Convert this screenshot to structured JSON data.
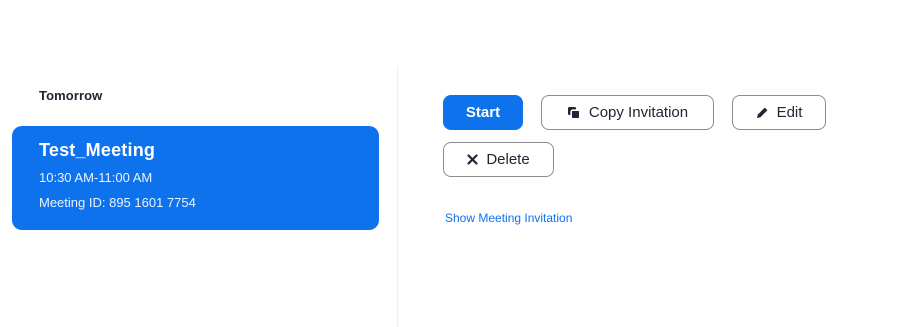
{
  "meeting_list": {
    "section_heading": "Tomorrow",
    "selected_meeting": {
      "title": "Test_Meeting",
      "time": "10:30 AM-11:00 AM",
      "meeting_id_text": "Meeting ID: 895 1601 7754"
    }
  },
  "detail": {
    "buttons": {
      "start_label": "Start",
      "copy_invitation_label": "Copy Invitation",
      "edit_label": "Edit",
      "delete_label": "Delete"
    },
    "show_invitation_link": "Show Meeting Invitation"
  },
  "icons": {
    "copy": "copy-icon",
    "edit": "pencil-icon",
    "delete": "close-icon"
  },
  "colors": {
    "accent": "#0e72ed",
    "text": "#232333",
    "button_border": "#8b8b94",
    "divider": "#ededf4"
  }
}
